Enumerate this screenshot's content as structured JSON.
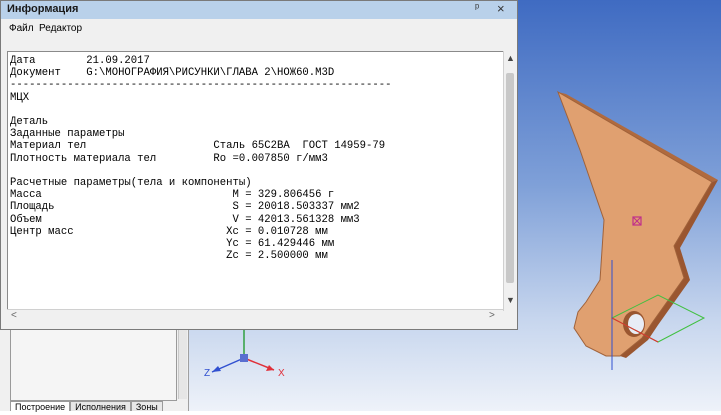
{
  "window": {
    "title": "Информация",
    "pin_glyph": "ᵖ",
    "close_glyph": "×",
    "menu": [
      "Файл",
      "Редактор"
    ]
  },
  "report_lines": [
    "Дата        21.09.2017",
    "Документ    G:\\МОНОГРАФИЯ\\РИСУНКИ\\ГЛАВА 2\\НОЖ60.M3D",
    "------------------------------------------------------------",
    "МЦХ",
    "",
    "Деталь",
    "Заданные параметры",
    "Материал тел                    Сталь 65С2ВА  ГОСТ 14959-79",
    "Плотность материала тел         Ro =0.007850 г/мм3",
    "",
    "Расчетные параметры(тела и компоненты)",
    "Масса                              M = 329.806456 г",
    "Площадь                            S = 20018.503337 мм2",
    "Объем                              V = 42013.561328 мм3",
    "Центр масс                        Xc = 0.010728 мм",
    "                                  Yc = 61.429446 мм",
    "                                  Zc = 2.500000 мм"
  ],
  "scroll": {
    "up": "▲",
    "down": "▼",
    "left": "<",
    "right": ">"
  },
  "tabs": [
    "Построение",
    "Исполнения",
    "Зоны"
  ],
  "axes": {
    "x_label": "X",
    "z_label": "Z"
  },
  "colors": {
    "part_fill": "#e0a070",
    "part_edge": "#a0623a",
    "titlebar": "#b9d1ea",
    "axis_x": "#e0303a",
    "axis_y": "#30a040",
    "axis_z": "#3050d0"
  }
}
